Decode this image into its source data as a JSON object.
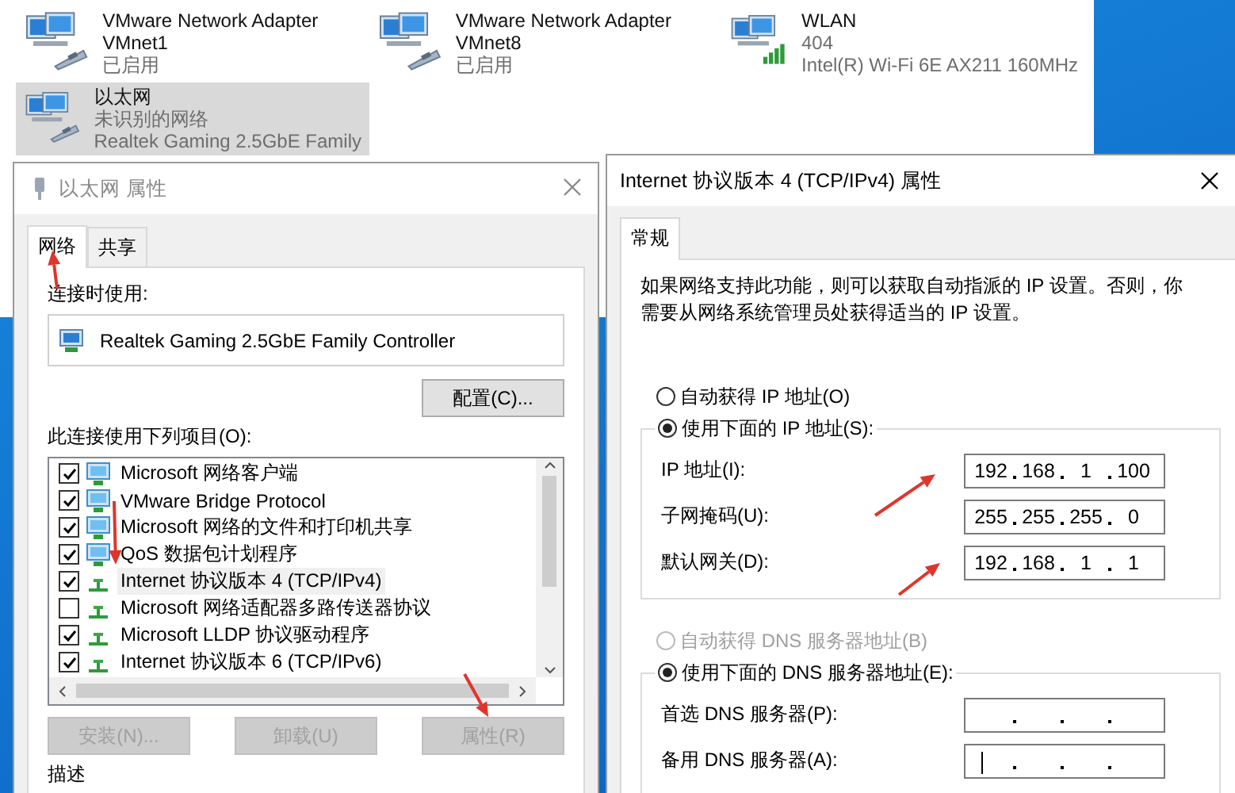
{
  "adapters": [
    {
      "name": "VMware Network Adapter VMnet1",
      "status": "已启用",
      "kind": "wired",
      "selected": false
    },
    {
      "name": "VMware Network Adapter VMnet8",
      "status": "已启用",
      "kind": "wired",
      "selected": false
    },
    {
      "name": "WLAN",
      "status": "404",
      "device": "Intel(R) Wi-Fi 6E AX211 160MHz",
      "kind": "wifi",
      "selected": false
    },
    {
      "name": "以太网",
      "status": "未识别的网络",
      "device": "Realtek Gaming 2.5GbE Family",
      "kind": "wired",
      "selected": true
    }
  ],
  "ethernet_dialog": {
    "title": "以太网 属性",
    "tabs": [
      {
        "label": "网络",
        "selected": true
      },
      {
        "label": "共享",
        "selected": false
      }
    ],
    "connect_using_label": "连接时使用:",
    "adapter_name": "Realtek Gaming 2.5GbE Family Controller",
    "configure_button": "配置(C)...",
    "items_label": "此连接使用下列项目(O):",
    "items": [
      {
        "label": "Microsoft 网络客户端",
        "kind": "client",
        "checked": true,
        "selected": false
      },
      {
        "label": "VMware Bridge Protocol",
        "kind": "client",
        "checked": true,
        "selected": false
      },
      {
        "label": "Microsoft 网络的文件和打印机共享",
        "kind": "client",
        "checked": true,
        "selected": false
      },
      {
        "label": "QoS 数据包计划程序",
        "kind": "client",
        "checked": true,
        "selected": false
      },
      {
        "label": "Internet 协议版本 4 (TCP/IPv4)",
        "kind": "protocol",
        "checked": true,
        "selected": true
      },
      {
        "label": "Microsoft 网络适配器多路传送器协议",
        "kind": "protocol",
        "checked": false,
        "selected": false
      },
      {
        "label": "Microsoft LLDP 协议驱动程序",
        "kind": "protocol",
        "checked": true,
        "selected": false
      },
      {
        "label": "Internet 协议版本 6 (TCP/IPv6)",
        "kind": "protocol",
        "checked": true,
        "selected": false
      }
    ],
    "buttons": [
      {
        "label": "安装(N)...",
        "disabled": true
      },
      {
        "label": "卸载(U)",
        "disabled": true
      },
      {
        "label": "属性(R)",
        "disabled": true
      }
    ],
    "description_label": "描述"
  },
  "ipv4_dialog": {
    "title": "Internet 协议版本 4 (TCP/IPv4) 属性",
    "tabs": [
      {
        "label": "常规",
        "selected": true
      }
    ],
    "description": "如果网络支持此功能，则可以获取自动指派的 IP 设置。否则，你需要从网络系统管理员处获得适当的 IP 设置。",
    "ip_options": [
      {
        "label": "自动获得 IP 地址(O)",
        "selected": false,
        "disabled": false
      },
      {
        "label": "使用下面的 IP 地址(S):",
        "selected": true,
        "disabled": false
      }
    ],
    "ip_fields": [
      {
        "label": "IP 地址(I):",
        "octets": [
          "192",
          "168",
          "1",
          "100"
        ],
        "focused": false
      },
      {
        "label": "子网掩码(U):",
        "octets": [
          "255",
          "255",
          "255",
          "0"
        ],
        "focused": false
      },
      {
        "label": "默认网关(D):",
        "octets": [
          "192",
          "168",
          "1",
          "1"
        ],
        "focused": false
      }
    ],
    "dns_options": [
      {
        "label": "自动获得 DNS 服务器地址(B)",
        "selected": false,
        "disabled": true
      },
      {
        "label": "使用下面的 DNS 服务器地址(E):",
        "selected": true,
        "disabled": false
      }
    ],
    "dns_fields": [
      {
        "label": "首选 DNS 服务器(P):",
        "focused": false
      },
      {
        "label": "备用 DNS 服务器(A):",
        "focused": true
      }
    ]
  }
}
